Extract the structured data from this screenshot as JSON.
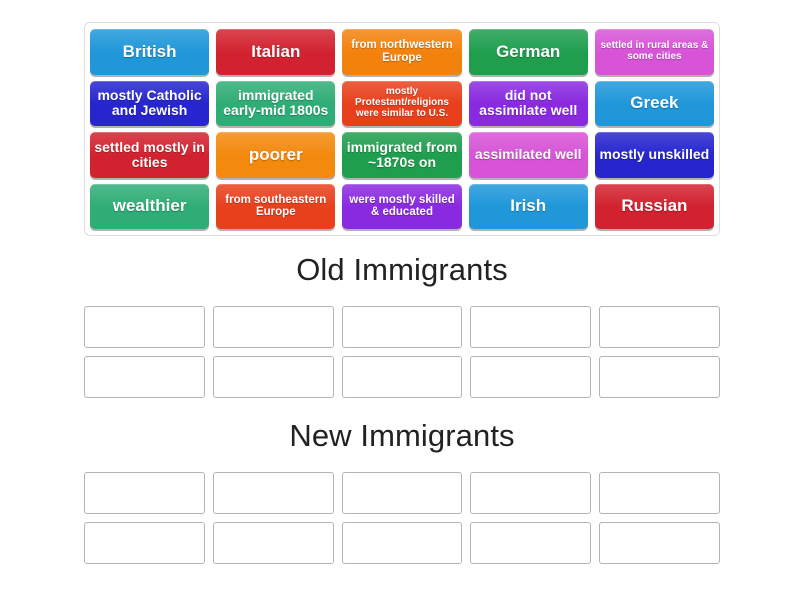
{
  "activity": {
    "type": "group-sort",
    "tile_bank": {
      "tiles": [
        {
          "label": "British",
          "color": "#1f97d9",
          "size": "lg"
        },
        {
          "label": "Italian",
          "color": "#d2222f",
          "size": "lg"
        },
        {
          "label": "from northwestern Europe",
          "color": "#f3820d",
          "size": "sm"
        },
        {
          "label": "German",
          "color": "#1f9e4e",
          "size": "lg"
        },
        {
          "label": "settled in rural areas & some cities",
          "color": "#d754d7",
          "size": "xs"
        },
        {
          "label": "mostly Catholic and Jewish",
          "color": "#2625ce",
          "size": "md"
        },
        {
          "label": "immigrated early-mid 1800s",
          "color": "#2fad76",
          "size": "md"
        },
        {
          "label": "mostly Protestant/religions were similar to U.S.",
          "color": "#e8401c",
          "size": "xs"
        },
        {
          "label": "did not assimilate well",
          "color": "#8a2ae0",
          "size": "md"
        },
        {
          "label": "Greek",
          "color": "#1f97d9",
          "size": "lg"
        },
        {
          "label": "settled mostly in cities",
          "color": "#d2222f",
          "size": "md"
        },
        {
          "label": "poorer",
          "color": "#f3890d",
          "size": "lg"
        },
        {
          "label": "immigrated from ~1870s on",
          "color": "#1f9e4e",
          "size": "md"
        },
        {
          "label": "assimilated well",
          "color": "#d754d7",
          "size": "md"
        },
        {
          "label": "mostly unskilled",
          "color": "#2625ce",
          "size": "md"
        },
        {
          "label": "wealthier",
          "color": "#2fad76",
          "size": "lg"
        },
        {
          "label": "from southeastern Europe",
          "color": "#e8401c",
          "size": "sm"
        },
        {
          "label": "were mostly skilled & educated",
          "color": "#8a2ae0",
          "size": "sm"
        },
        {
          "label": "Irish",
          "color": "#1f97d9",
          "size": "lg"
        },
        {
          "label": "Russian",
          "color": "#d2222f",
          "size": "lg"
        }
      ]
    },
    "groups": [
      {
        "title": "Old Immigrants",
        "slots": [
          "",
          "",
          "",
          "",
          "",
          "",
          "",
          "",
          "",
          ""
        ]
      },
      {
        "title": "New Immigrants",
        "slots": [
          "",
          "",
          "",
          "",
          "",
          "",
          "",
          "",
          "",
          ""
        ]
      }
    ]
  }
}
